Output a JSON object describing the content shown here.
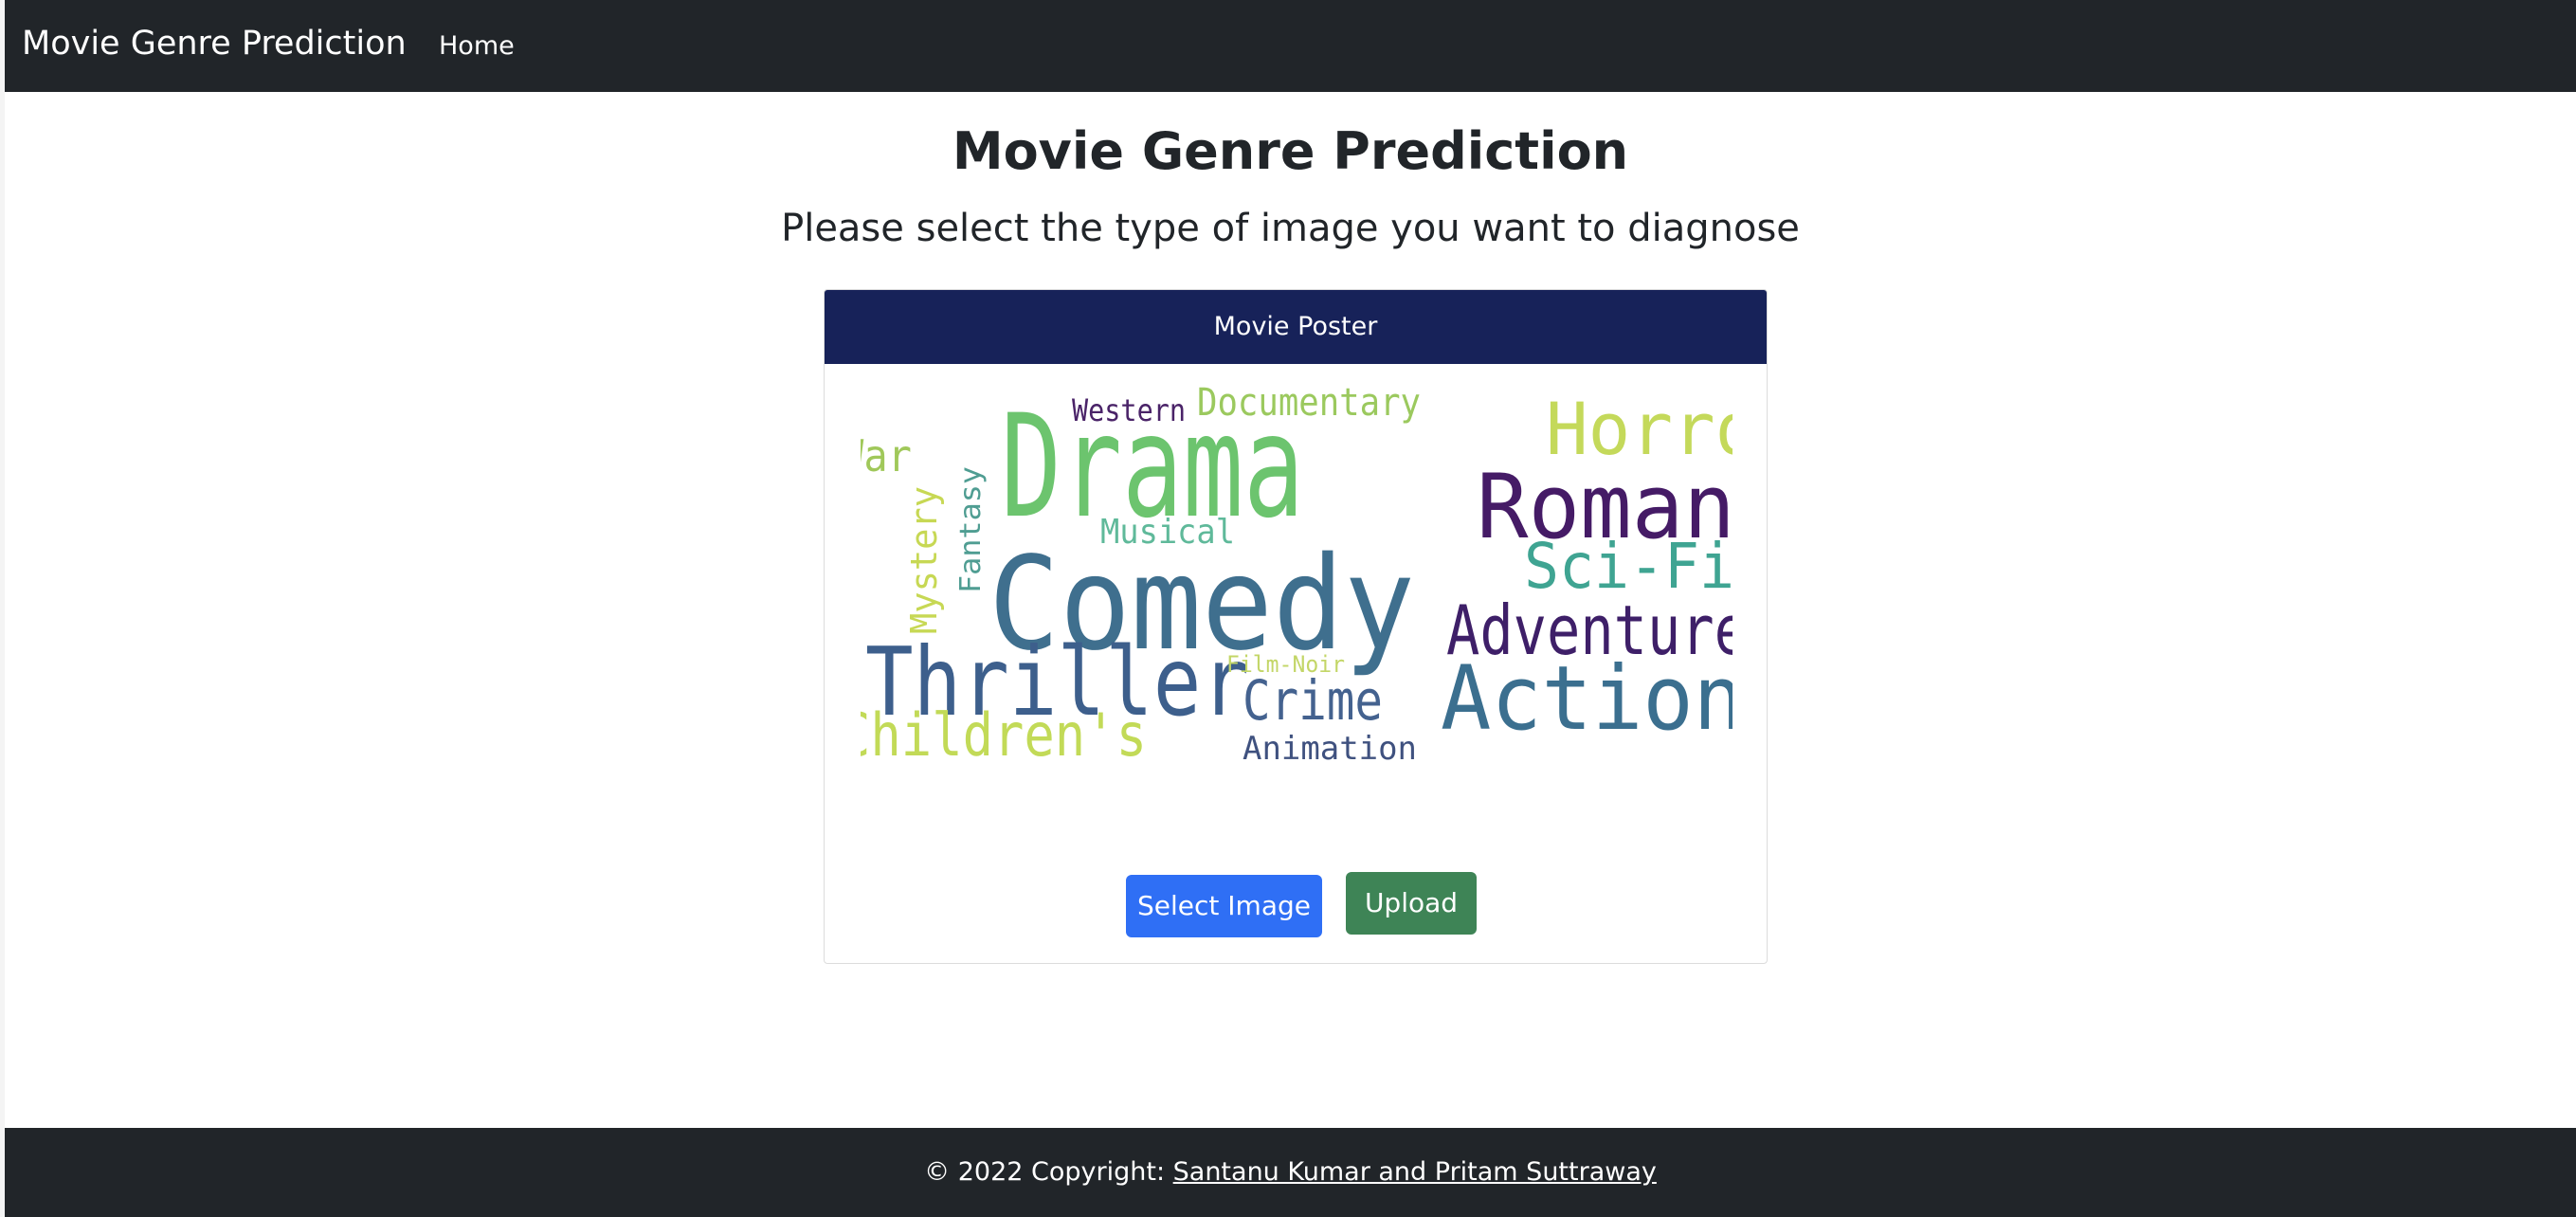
{
  "navbar": {
    "brand": "Movie Genre Prediction",
    "links": [
      "Home"
    ]
  },
  "main": {
    "title": "Movie Genre Prediction",
    "subtitle": "Please select the type of image you want to diagnose"
  },
  "card": {
    "header": "Movie Poster",
    "wordcloud_words": [
      {
        "text": "Drama",
        "color": "#6cc46e"
      },
      {
        "text": "Comedy",
        "color": "#3f6f8e"
      },
      {
        "text": "Horror",
        "color": "#c4d95a"
      },
      {
        "text": "Romance",
        "color": "#451b66"
      },
      {
        "text": "Thriller",
        "color": "#3d5f8c"
      },
      {
        "text": "Action",
        "color": "#3b6f8f"
      },
      {
        "text": "Adventure",
        "color": "#3e1f68"
      },
      {
        "text": "Sci-Fi",
        "color": "#3fa492"
      },
      {
        "text": "Children's",
        "color": "#c2da57"
      },
      {
        "text": "Crime",
        "color": "#44628f"
      },
      {
        "text": "Documentary",
        "color": "#9bc95e"
      },
      {
        "text": "Western",
        "color": "#4a2368"
      },
      {
        "text": "War",
        "color": "#a0c85a"
      },
      {
        "text": "Mystery",
        "color": "#c7d854"
      },
      {
        "text": "Fantasy",
        "color": "#4f9d92"
      },
      {
        "text": "Musical",
        "color": "#5fb99a"
      },
      {
        "text": "Film-Noir",
        "color": "#c3d667"
      },
      {
        "text": "Animation",
        "color": "#3f517f"
      }
    ],
    "select_button": "Select Image",
    "upload_button": "Upload"
  },
  "footer": {
    "copyright": "© 2022 Copyright: ",
    "authors_link": "Santanu Kumar and Pritam Suttraway"
  },
  "colors": {
    "navbar_bg": "#212529",
    "card_header_bg": "#172259",
    "select_button_bg": "#2f6ff5",
    "upload_button_bg": "#3e8456"
  }
}
